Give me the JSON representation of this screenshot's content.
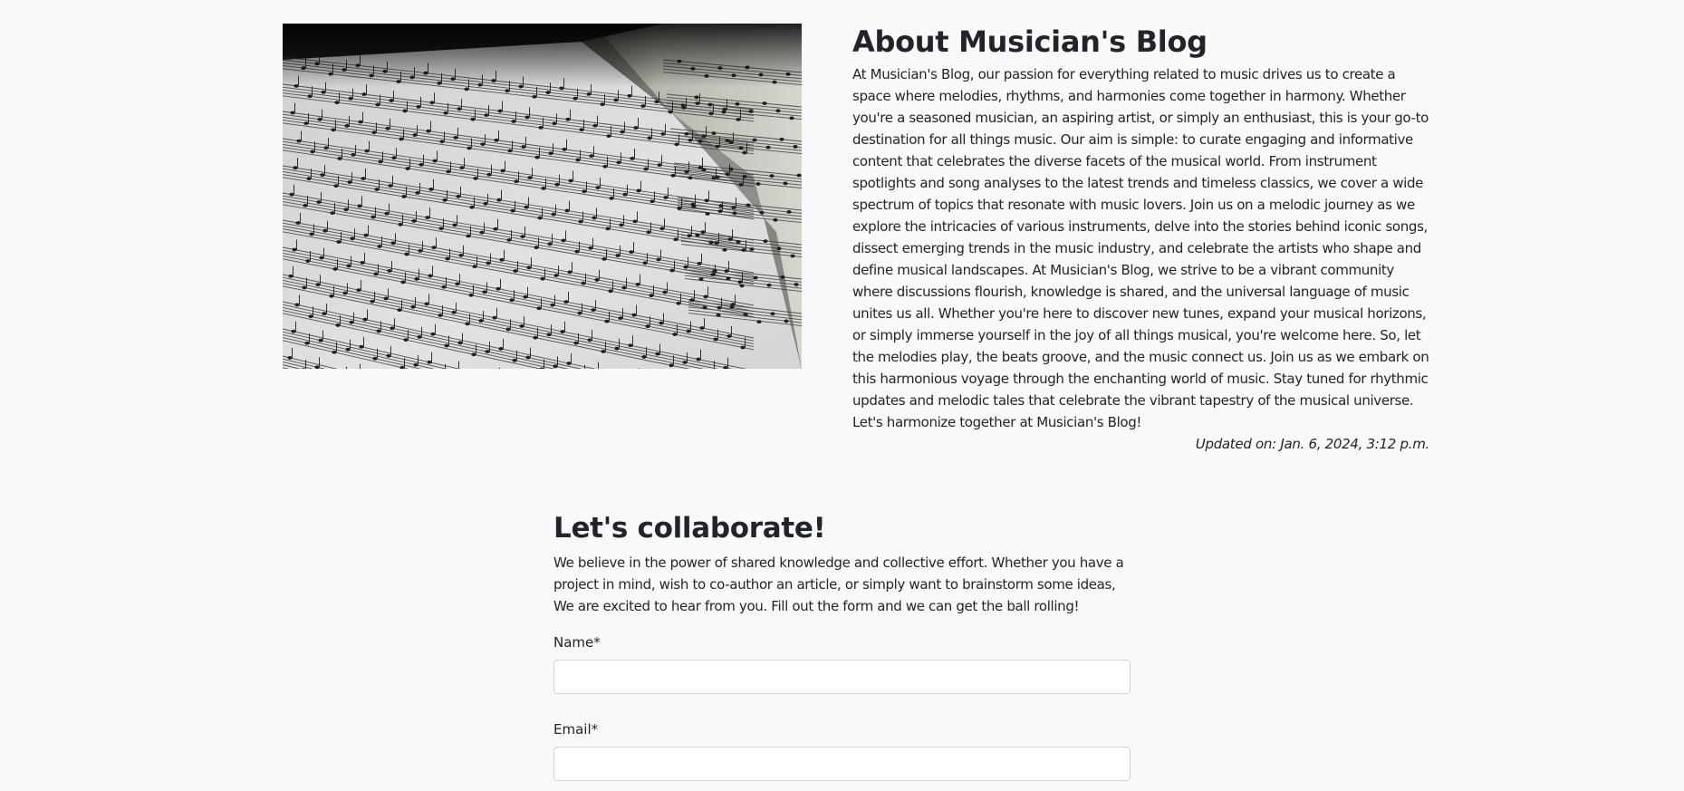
{
  "about": {
    "image_alt": "Open book of sheet music",
    "title": "About Musician's Blog",
    "body": "At Musician's Blog, our passion for everything related to music drives us to create a space where melodies, rhythms, and harmonies come together in harmony. Whether you're a seasoned musician, an aspiring artist, or simply an enthusiast, this is your go-to destination for all things music. Our aim is simple: to curate engaging and informative content that celebrates the diverse facets of the musical world. From instrument spotlights and song analyses to the latest trends and timeless classics, we cover a wide spectrum of topics that resonate with music lovers. Join us on a melodic journey as we explore the intricacies of various instruments, delve into the stories behind iconic songs, dissect emerging trends in the music industry, and celebrate the artists who shape and define musical landscapes. At Musician's Blog, we strive to be a vibrant community where discussions flourish, knowledge is shared, and the universal language of music unites us all. Whether you're here to discover new tunes, expand your musical horizons, or simply immerse yourself in the joy of all things musical, you're welcome here. So, let the melodies play, the beats groove, and the music connect us. Join us as we embark on this harmonious voyage through the enchanting world of music. Stay tuned for rhythmic updates and melodic tales that celebrate the vibrant tapestry of the musical universe. Let's harmonize together at Musician's Blog!",
    "updated": "Updated on: Jan. 6, 2024, 3:12 p.m."
  },
  "collab": {
    "title": "Let's collaborate!",
    "body": "We believe in the power of shared knowledge and collective effort. Whether you have a project in mind, wish to co-author an article, or simply want to brainstorm some ideas, We are excited to hear from you. Fill out the form and we can get the ball rolling!",
    "form": {
      "name_label": "Name*",
      "name_value": "",
      "email_label": "Email*",
      "email_value": ""
    }
  },
  "colors": {
    "background": "#f8f9fa",
    "text": "#212529",
    "input_border": "#ced4da"
  }
}
